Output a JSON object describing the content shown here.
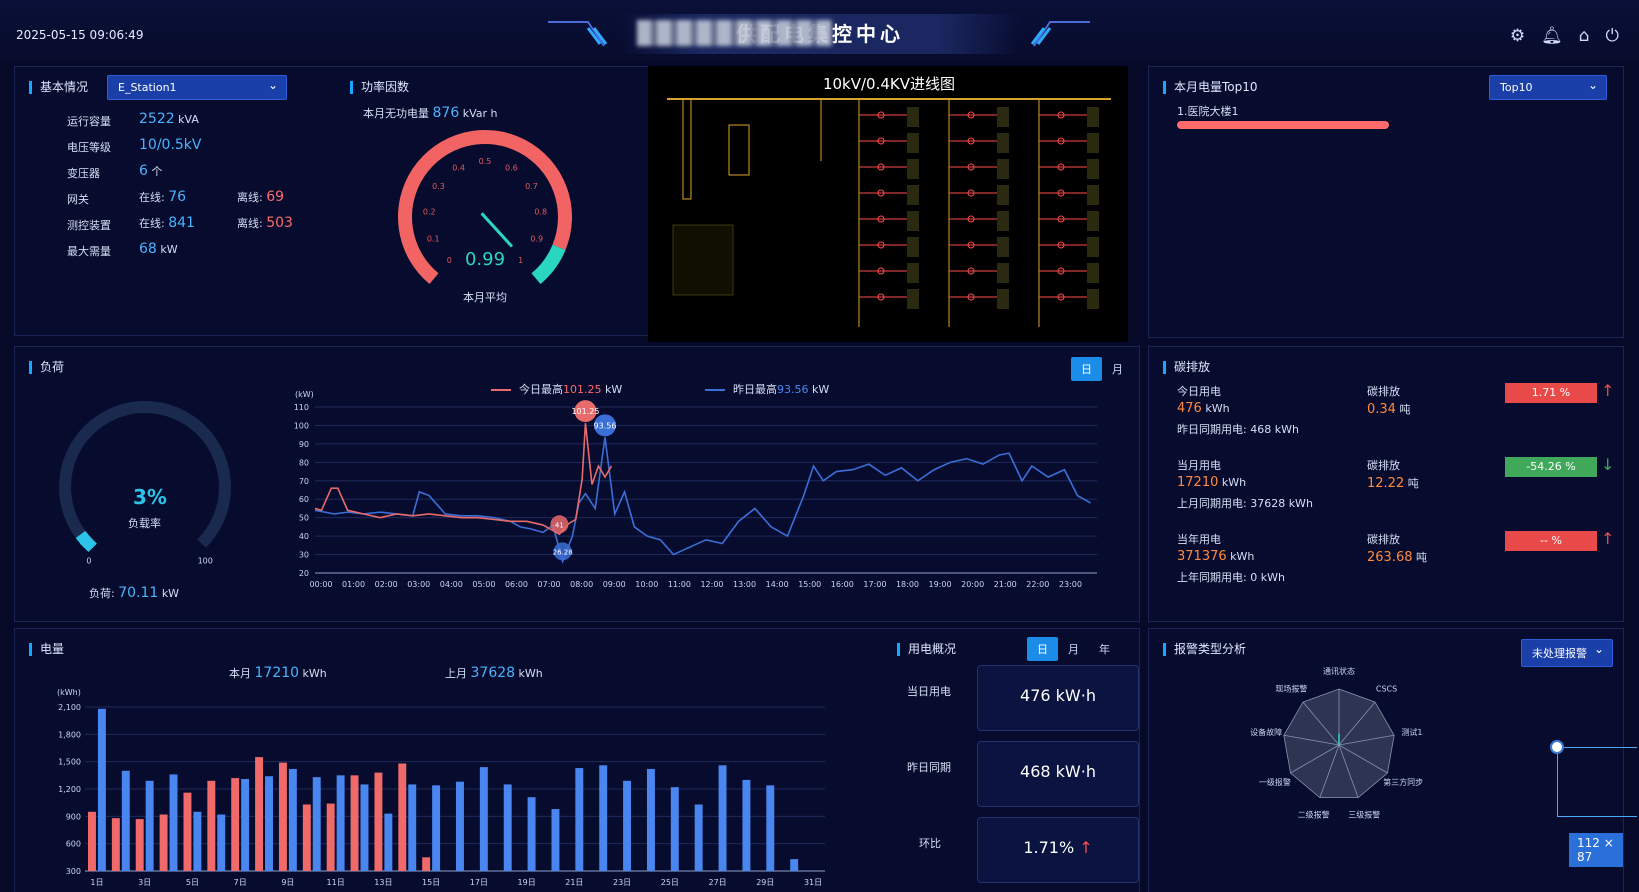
{
  "header": {
    "datetime": "2025-05-15 09:06:49",
    "title_visible": "供配电集控中心",
    "icons": [
      "settings-icon",
      "bell-icon",
      "home-icon",
      "power-icon"
    ]
  },
  "basic": {
    "title": "基本情况",
    "station": "E_Station1",
    "rows": [
      {
        "label": "运行容量",
        "value": "2522",
        "unit": "kVA"
      },
      {
        "label": "电压等级",
        "value": "10/0.5kV",
        "unit": ""
      },
      {
        "label": "变压器",
        "value": "6",
        "unit": "个"
      }
    ],
    "gateway": {
      "label": "网关",
      "online_label": "在线:",
      "online": "76",
      "offline_label": "离线:",
      "offline": "69"
    },
    "monitor": {
      "label": "测控装置",
      "online_label": "在线:",
      "online": "841",
      "offline_label": "离线:",
      "offline": "503"
    },
    "maxdemand": {
      "label": "最大需量",
      "value": "68",
      "unit": "kW"
    }
  },
  "pf": {
    "title": "功率因数",
    "reactive_label": "本月无功电量",
    "reactive_value": "876",
    "reactive_unit": "kVar h",
    "value": "0.99",
    "footer": "本月平均",
    "value_num": 0.99,
    "ticks": [
      "0",
      "0.1",
      "0.2",
      "0.3",
      "0.4",
      "0.5",
      "0.6",
      "0.7",
      "0.8",
      "0.9",
      "1"
    ]
  },
  "diagram": {
    "title": "10kV/0.4KV进线图"
  },
  "top10": {
    "title": "本月电量Top10",
    "select": "Top10",
    "items": [
      {
        "label": "1.医院大楼1",
        "fraction": 1.0
      }
    ]
  },
  "load": {
    "title": "负荷",
    "gauge_value": "3%",
    "gauge_label": "负载率",
    "gauge_fraction": 0.03,
    "gauge_min": "0",
    "gauge_max": "100",
    "load_label": "负荷:",
    "load_value": "70.11",
    "load_unit": "kW",
    "tabs": [
      "日",
      "月"
    ],
    "legend_today": "今日最高",
    "legend_today_val": "101.25",
    "legend_yest": "昨日最高",
    "legend_yest_val": "93.56",
    "legend_unit": "kW"
  },
  "carbon": {
    "title": "碳排放",
    "blocks": [
      {
        "use_label": "今日用电",
        "use": "476",
        "use_unit": "kWh",
        "em_label": "碳排放",
        "em": "0.34",
        "em_unit": "吨",
        "prev": "昨日同期用电: 468 kWh",
        "pct": "1.71 %",
        "color": "#e84a4a",
        "dir": "↑"
      },
      {
        "use_label": "当月用电",
        "use": "17210",
        "use_unit": "kWh",
        "em_label": "碳排放",
        "em": "12.22",
        "em_unit": "吨",
        "prev": "上月同期用电: 37628 kWh",
        "pct": "-54.26 %",
        "color": "#3fa85a",
        "dir": "↓"
      },
      {
        "use_label": "当年用电",
        "use": "371376",
        "use_unit": "kWh",
        "em_label": "碳排放",
        "em": "263.68",
        "em_unit": "吨",
        "prev": "上年同期用电: 0 kWh",
        "pct": "-- %",
        "color": "#e84a4a",
        "dir": "↑"
      }
    ]
  },
  "energy": {
    "title": "电量",
    "this_label": "本月",
    "this_val": "17210",
    "prev_label": "上月",
    "prev_val": "37628",
    "unit": "kWh"
  },
  "usage": {
    "title": "用电概况",
    "tabs": [
      "日",
      "月",
      "年"
    ],
    "rows": [
      {
        "label": "当日用电",
        "value": "476 kW·h"
      },
      {
        "label": "昨日同期",
        "value": "468 kW·h"
      },
      {
        "label": "环比",
        "value": "1.71%"
      }
    ]
  },
  "alarm": {
    "title": "报警类型分析",
    "select": "未处理报警",
    "size_badge": "112 × 87",
    "axes": [
      "通讯状态",
      "CSCS",
      "测试1",
      "第三方同步",
      "三级报警",
      "二级报警",
      "一级报警",
      "设备故障",
      "现场报警"
    ]
  },
  "chart_data": [
    {
      "type": "line",
      "name": "load",
      "ylabel": "(kW)",
      "ylim": [
        20,
        110
      ],
      "yticks": [
        20,
        30,
        40,
        50,
        60,
        70,
        80,
        90,
        100,
        110
      ],
      "xticks": [
        "00:00",
        "01:00",
        "02:00",
        "03:00",
        "04:00",
        "05:00",
        "06:00",
        "07:00",
        "08:00",
        "09:00",
        "10:00",
        "11:00",
        "12:00",
        "13:00",
        "14:00",
        "15:00",
        "16:00",
        "17:00",
        "18:00",
        "19:00",
        "20:00",
        "21:00",
        "22:00",
        "23:00"
      ],
      "series": [
        {
          "name": "今日最高",
          "color": "#e86a6a",
          "x": [
            0,
            0.2,
            0.5,
            0.7,
            1,
            1.5,
            2,
            2.5,
            3,
            3.5,
            4,
            4.5,
            5,
            5.5,
            6,
            6.5,
            7,
            7.2,
            7.5,
            7.8,
            8,
            8.2,
            8.3,
            8.5,
            8.7,
            8.9,
            9.1
          ],
          "y": [
            55,
            54,
            66,
            66,
            54,
            52,
            50,
            52,
            51,
            52,
            51,
            50,
            50,
            49,
            48,
            48,
            46,
            44,
            41,
            47,
            49,
            71,
            101.25,
            68,
            78,
            72,
            78
          ]
        },
        {
          "name": "昨日最高",
          "color": "#3b6fd8",
          "x": [
            0,
            0.3,
            0.6,
            1,
            1.5,
            2,
            2.5,
            3,
            3.2,
            3.5,
            4,
            4.5,
            5,
            5.5,
            6,
            6.3,
            6.6,
            7,
            7.3,
            7.6,
            7.9,
            8.1,
            8.3,
            8.6,
            8.9,
            9.2,
            9.5,
            9.8,
            10.2,
            10.6,
            11,
            11.5,
            12,
            12.5,
            13,
            13.5,
            14,
            14.5,
            15,
            15.3,
            15.6,
            16,
            16.5,
            17,
            17.5,
            18,
            18.5,
            19,
            19.5,
            20,
            20.5,
            21,
            21.3,
            21.7,
            22,
            22.5,
            23,
            23.4,
            23.8
          ],
          "y": [
            54,
            53,
            52,
            53,
            52,
            53,
            52,
            51,
            64,
            62,
            52,
            51,
            51,
            50,
            48,
            45,
            44,
            42,
            46,
            26.28,
            40,
            58,
            63,
            55,
            93.56,
            52,
            64,
            45,
            40,
            38,
            30,
            34,
            38,
            36,
            48,
            55,
            45,
            40,
            62,
            78,
            70,
            75,
            76,
            79,
            73,
            77,
            70,
            76,
            80,
            82,
            79,
            84,
            85,
            70,
            78,
            72,
            76,
            62,
            58
          ]
        }
      ]
    },
    {
      "type": "bar",
      "name": "energy",
      "ylabel": "(kWh)",
      "ylim": [
        300,
        2100
      ],
      "yticks": [
        300,
        600,
        900,
        1200,
        1500,
        1800,
        2100
      ],
      "categories": [
        "1日",
        "2日",
        "3日",
        "4日",
        "5日",
        "6日",
        "7日",
        "8日",
        "9日",
        "10日",
        "11日",
        "12日",
        "13日",
        "14日",
        "15日",
        "16日",
        "17日",
        "18日",
        "19日",
        "20日",
        "21日",
        "22日",
        "23日",
        "24日",
        "25日",
        "26日",
        "27日",
        "28日",
        "29日",
        "30日",
        "31日"
      ],
      "xtick_labels": [
        "1日",
        "3日",
        "5日",
        "7日",
        "9日",
        "11日",
        "13日",
        "15日",
        "17日",
        "19日",
        "21日",
        "23日",
        "25日",
        "27日",
        "29日",
        "31日"
      ],
      "series": [
        {
          "name": "上月",
          "color": "#f06a6a",
          "values": [
            950,
            880,
            870,
            920,
            1160,
            1290,
            1320,
            1550,
            1490,
            1030,
            1040,
            1350,
            1380,
            1480,
            450,
            null,
            null,
            null,
            null,
            null,
            null,
            null,
            null,
            null,
            null,
            null,
            null,
            null,
            null,
            null,
            null
          ]
        },
        {
          "name": "本月",
          "color": "#4a86f0",
          "values": [
            2080,
            1400,
            1290,
            1360,
            950,
            920,
            1310,
            1340,
            1420,
            1330,
            1350,
            1250,
            930,
            1250,
            1240,
            1280,
            1440,
            1250,
            1110,
            980,
            1430,
            1460,
            1290,
            1420,
            1220,
            1030,
            1460,
            1300,
            1240,
            430,
            0
          ]
        }
      ]
    },
    {
      "type": "radar",
      "name": "alarm",
      "axes": [
        "通讯状态",
        "CSCS",
        "测试1",
        "第三方同步",
        "三级报警",
        "二级报警",
        "一级报警",
        "设备故障",
        "现场报警"
      ],
      "values": [
        0.2,
        0,
        0,
        0,
        0,
        0,
        0,
        0,
        0
      ]
    }
  ]
}
